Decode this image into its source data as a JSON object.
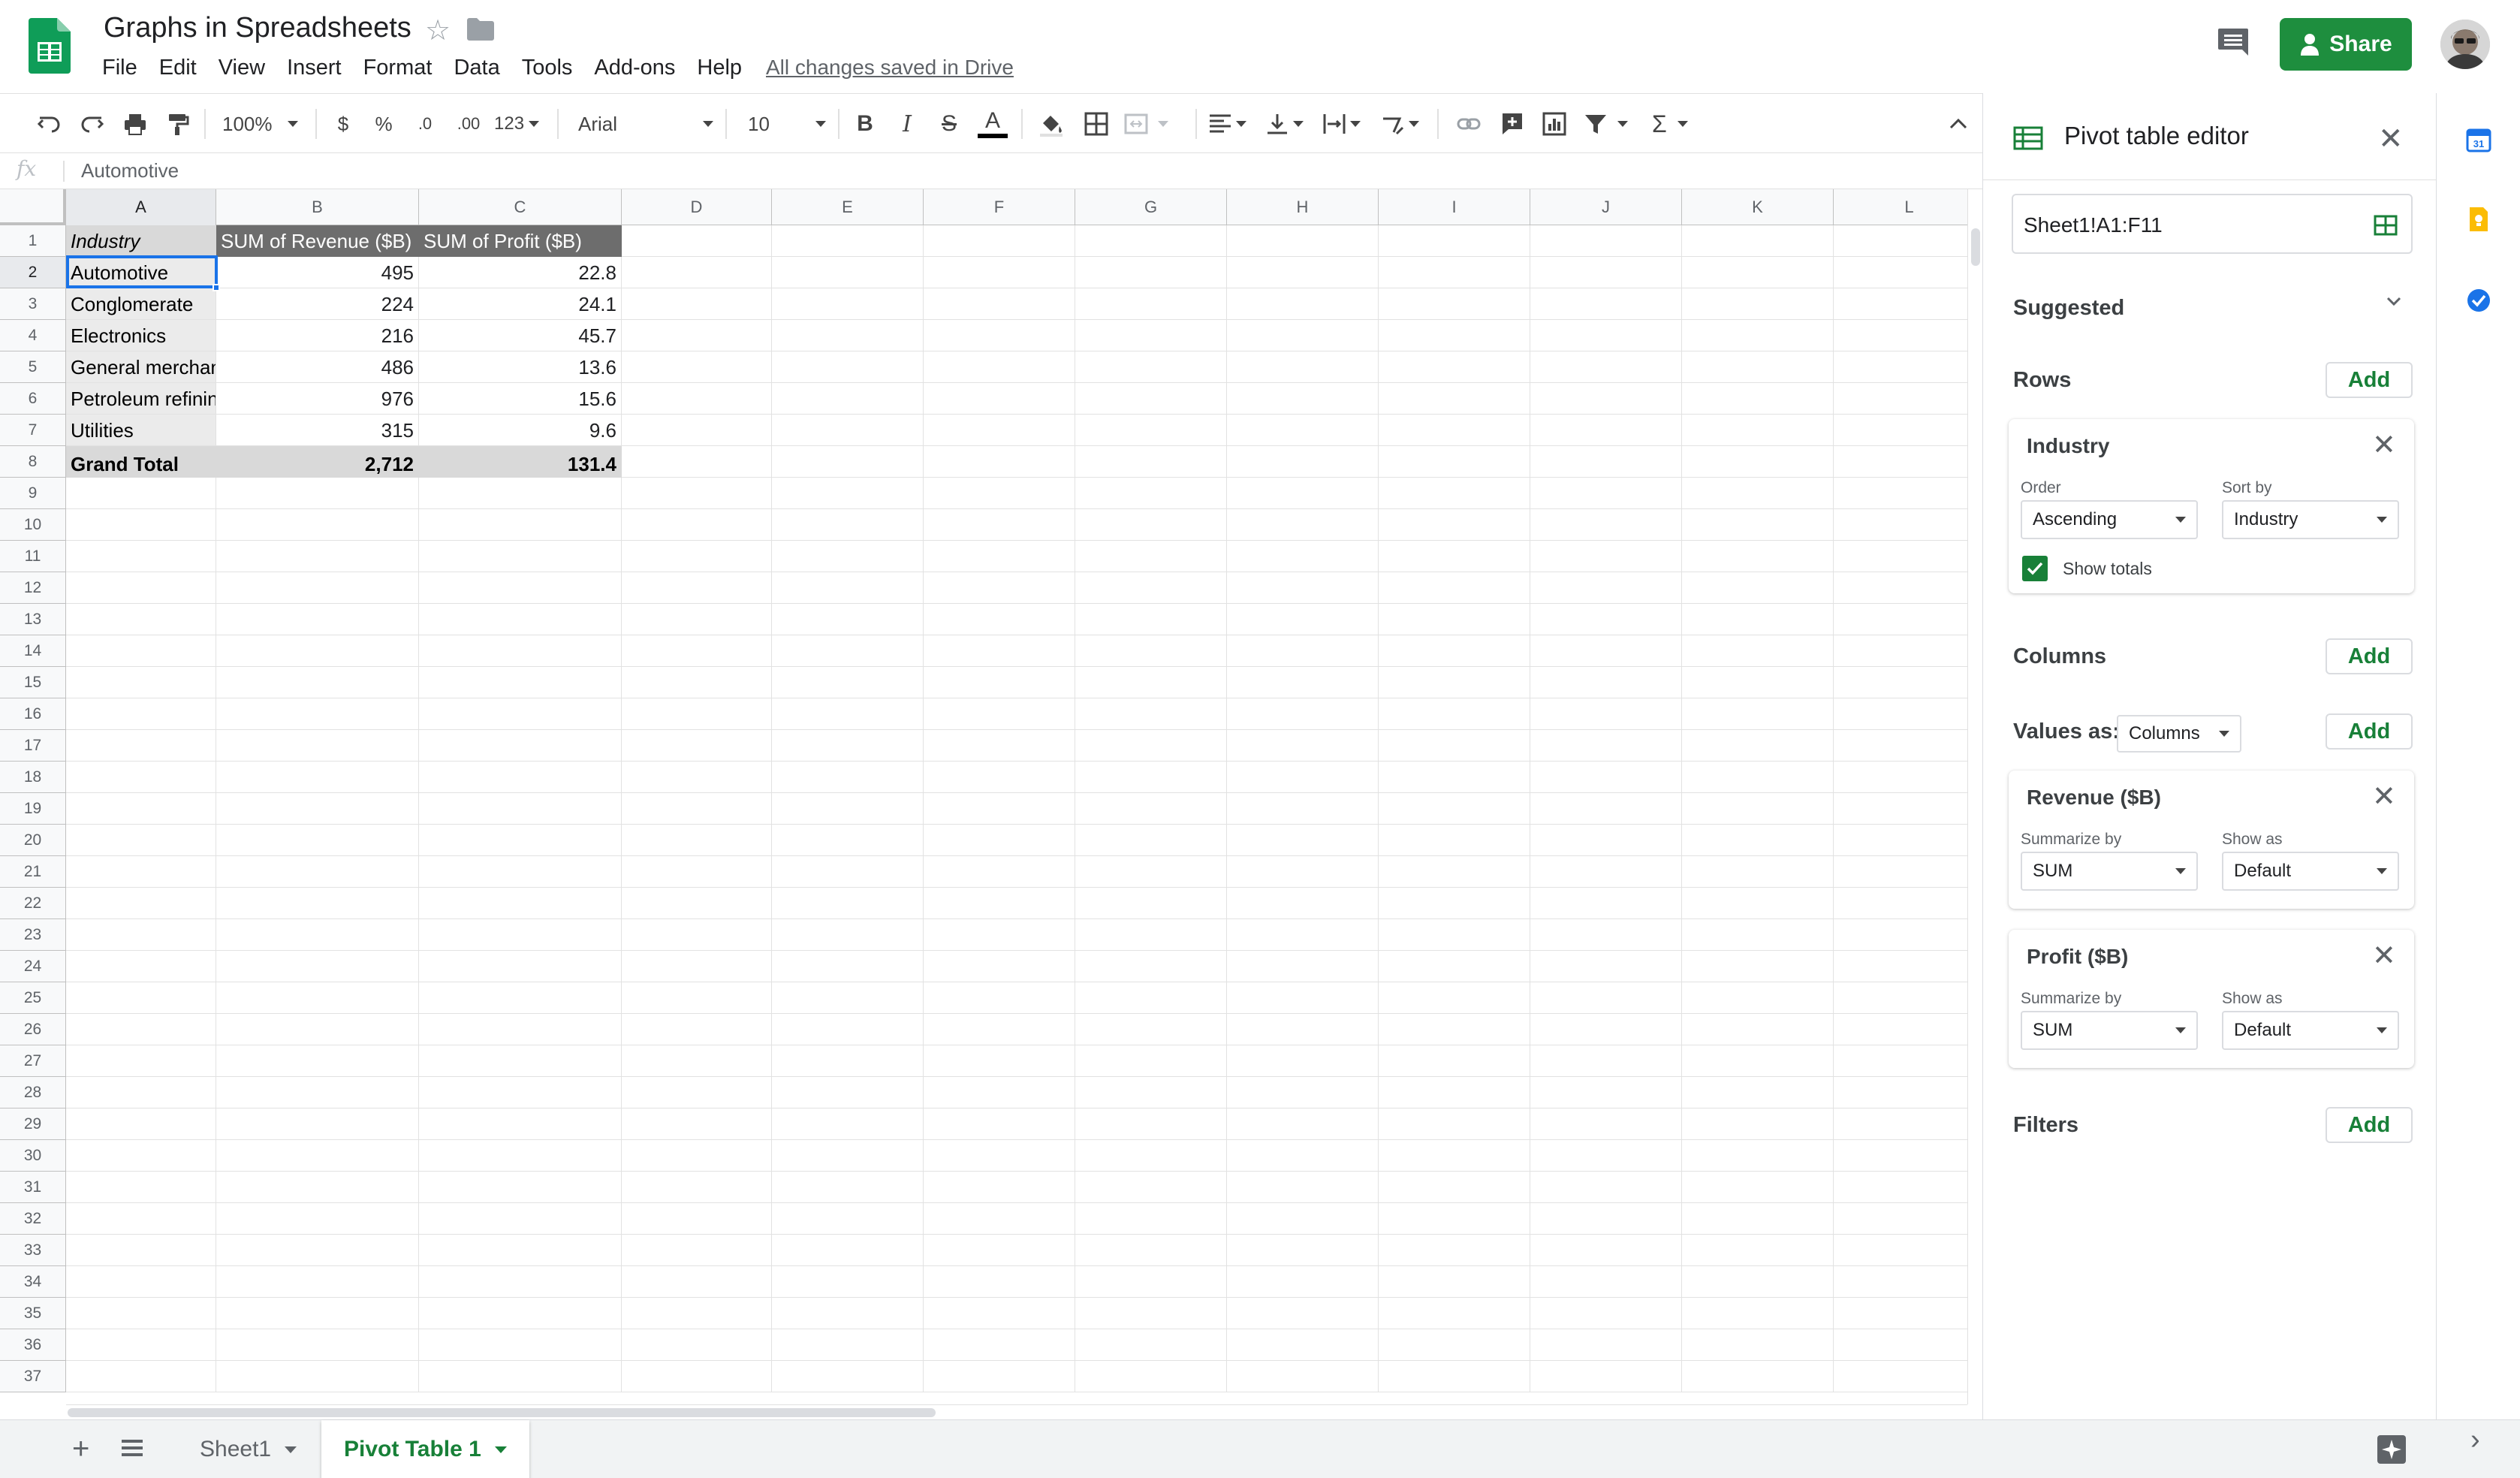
{
  "header": {
    "title": "Graphs in Spreadsheets",
    "menu": [
      "File",
      "Edit",
      "View",
      "Insert",
      "Format",
      "Data",
      "Tools",
      "Add-ons",
      "Help"
    ],
    "save_status": "All changes saved in Drive",
    "share_label": "Share"
  },
  "toolbar": {
    "zoom": "100%",
    "currency": "$",
    "percent": "%",
    "decrease_decimals": ".0",
    "increase_decimals": ".00",
    "more_formats": "123",
    "font": "Arial",
    "font_size": "10",
    "icons": [
      "undo-icon",
      "redo-icon",
      "print-icon",
      "paint-format-icon",
      "bold-icon",
      "italic-icon",
      "strikethrough-icon",
      "text-color-icon",
      "fill-color-icon",
      "borders-icon",
      "merge-cells-icon",
      "horizontal-align-icon",
      "vertical-align-icon",
      "text-wrap-icon",
      "text-rotation-icon",
      "link-icon",
      "comment-icon",
      "chart-icon",
      "filter-icon",
      "functions-icon",
      "collapse-icon"
    ]
  },
  "formula_bar": {
    "fx": "fx",
    "value": "Automotive"
  },
  "grid": {
    "columns": [
      "A",
      "B",
      "C",
      "D",
      "E",
      "F",
      "G",
      "H",
      "I",
      "J",
      "K",
      "L"
    ],
    "selected_column": "A",
    "selected_row": "2",
    "rows": [
      "1",
      "2",
      "3",
      "4",
      "5",
      "6",
      "7",
      "8",
      "9",
      "10",
      "11",
      "12",
      "13",
      "14",
      "15",
      "16",
      "17",
      "18",
      "19",
      "20",
      "21",
      "22",
      "23",
      "24",
      "25",
      "26",
      "27",
      "28",
      "29",
      "30",
      "31",
      "32",
      "33",
      "34",
      "35",
      "36",
      "37"
    ],
    "pivot": {
      "headers": [
        "Industry",
        "SUM of Revenue ($B)",
        "SUM of Profit ($B)"
      ],
      "data": [
        [
          "Automotive",
          "495",
          "22.8"
        ],
        [
          "Conglomerate",
          "224",
          "24.1"
        ],
        [
          "Electronics",
          "216",
          "45.7"
        ],
        [
          "General merchandise",
          "486",
          "13.6"
        ],
        [
          "Petroleum refining",
          "976",
          "15.6"
        ],
        [
          "Utilities",
          "315",
          "9.6"
        ]
      ],
      "total": [
        "Grand Total",
        "2,712",
        "131.4"
      ]
    }
  },
  "sheets": {
    "tabs": [
      {
        "label": "Sheet1",
        "active": false
      },
      {
        "label": "Pivot Table 1",
        "active": true
      }
    ]
  },
  "editor": {
    "title": "Pivot table editor",
    "range": "Sheet1!A1:F11",
    "suggested_label": "Suggested",
    "rows_label": "Rows",
    "columns_label": "Columns",
    "values_label": "Values as:",
    "values_as": "Columns",
    "filters_label": "Filters",
    "add_label": "Add",
    "row_card": {
      "title": "Industry",
      "order_label": "Order",
      "order_value": "Ascending",
      "sort_label": "Sort by",
      "sort_value": "Industry",
      "show_totals_label": "Show totals"
    },
    "value_cards": [
      {
        "title": "Revenue ($B)",
        "summarize_label": "Summarize by",
        "summarize_value": "SUM",
        "show_as_label": "Show as",
        "show_as_value": "Default"
      },
      {
        "title": "Profit ($B)",
        "summarize_label": "Summarize by",
        "summarize_value": "SUM",
        "show_as_label": "Show as",
        "show_as_value": "Default"
      }
    ]
  },
  "colors": {
    "accent": "#188038",
    "share": "#1e8e3e",
    "selection": "#1a73e8",
    "pivot_header": "#6d6d6d",
    "pivot_total": "#d9d9d9"
  }
}
